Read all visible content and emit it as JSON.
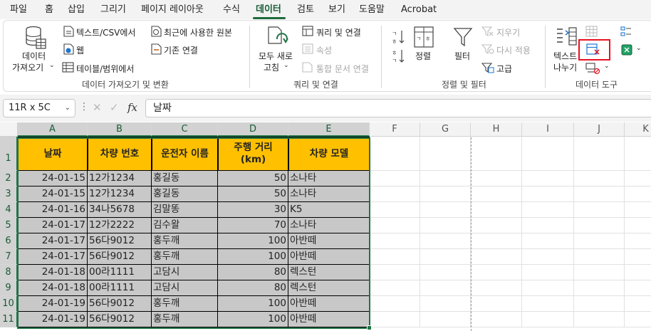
{
  "menu": {
    "items": [
      "파일",
      "홈",
      "삽입",
      "그리기",
      "페이지 레이아웃",
      "수식",
      "데이터",
      "검토",
      "보기",
      "도움말",
      "Acrobat"
    ],
    "active": "데이터"
  },
  "ribbon": {
    "get_data": {
      "label_line1": "데이터",
      "label_line2": "가져오기",
      "from_text_csv": "텍스트/CSV에서",
      "from_web": "웹",
      "from_table": "테이블/범위에서",
      "recent_sources": "최근에 사용한 원본",
      "existing_connections": "기존 연결",
      "group_label": "데이터 가져오기 및 변환"
    },
    "queries": {
      "refresh_line1": "모두 새로",
      "refresh_line2": "고침",
      "queries_connections": "쿼리 및 연결",
      "properties": "속성",
      "edit_links": "통합 문서 연결",
      "group_label": "쿼리 및 연결"
    },
    "sort_filter": {
      "sort": "정렬",
      "filter": "필터",
      "clear": "지우기",
      "reapply": "다시 적용",
      "advanced": "고급",
      "group_label": "정렬 및 필터"
    },
    "data_tools": {
      "text_to_columns_line1": "텍스트",
      "text_to_columns_line2": "나누기",
      "group_label": "데이터 도구"
    }
  },
  "formula_bar": {
    "name_box": "11R x 5C",
    "fx": "fx",
    "content": "날짜"
  },
  "sheet": {
    "columns": [
      "A",
      "B",
      "C",
      "D",
      "E",
      "F",
      "G",
      "H",
      "I",
      "J",
      "K"
    ],
    "rows": [
      "1",
      "2",
      "3",
      "4",
      "5",
      "6",
      "7",
      "8",
      "9",
      "10",
      "11"
    ],
    "headers": [
      "날짜",
      "차량 번호",
      "운전자 이름",
      "주행 거리\n(km)",
      "차량 모델"
    ],
    "data": [
      [
        "24-01-15",
        "12가1234",
        "홍길동",
        "50",
        "소나타"
      ],
      [
        "24-01-15",
        "12가1234",
        "홍길동",
        "50",
        "소나타"
      ],
      [
        "24-01-16",
        "34나5678",
        "김말똥",
        "30",
        "K5"
      ],
      [
        "24-01-17",
        "12가2222",
        "김수왈",
        "70",
        "소나타"
      ],
      [
        "24-01-17",
        "56다9012",
        "홍두깨",
        "100",
        "아반떼"
      ],
      [
        "24-01-17",
        "56다9012",
        "홍두깨",
        "100",
        "아반떼"
      ],
      [
        "24-01-18",
        "00라1111",
        "고담시",
        "80",
        "렉스턴"
      ],
      [
        "24-01-18",
        "00라1111",
        "고담시",
        "80",
        "렉스턴"
      ],
      [
        "24-01-19",
        "56다9012",
        "홍두깨",
        "100",
        "아반떼"
      ],
      [
        "24-01-19",
        "56다9012",
        "홍두깨",
        "100",
        "아반떼"
      ]
    ]
  },
  "colors": {
    "header_fill": "#ffc000",
    "data_fill": "#c8c8c8",
    "accent": "#217346",
    "highlight_box": "#e81123"
  }
}
